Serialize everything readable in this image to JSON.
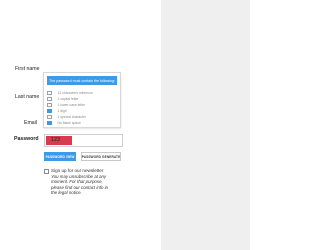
{
  "form": {
    "first_name_label": "First name",
    "last_name_label": "Last name",
    "email_label": "Email",
    "password_label": "Password"
  },
  "password_popover": {
    "header": "The password must contain the following:",
    "rules": [
      {
        "label": "12 characters minimum",
        "met": false
      },
      {
        "label": "1 capital letter",
        "met": false
      },
      {
        "label": "1 lower-case letter",
        "met": false
      },
      {
        "label": "1 digit",
        "met": true
      },
      {
        "label": "1 special character",
        "met": false
      },
      {
        "label": "No blank space",
        "met": true
      }
    ]
  },
  "password_field": {
    "value": "123",
    "strength_color": "#d93a4f"
  },
  "buttons": {
    "show_password": "PASSWORD VIEW",
    "generate_password": "PASSWORD GENERATE"
  },
  "newsletter": {
    "label": "Sign up for our newsletter",
    "note": "You may unsubscribe at any moment. For that purpose, please find our contact info in the legal notice."
  },
  "colors": {
    "accent": "#3b9be8",
    "weak": "#d93a4f",
    "gutter": "#efefef"
  }
}
